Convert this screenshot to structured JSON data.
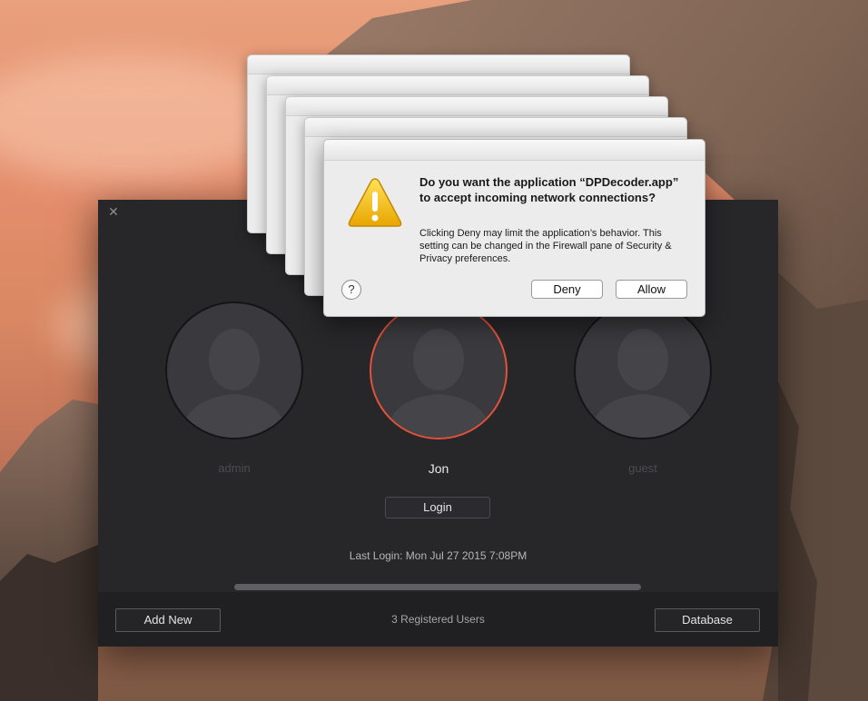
{
  "app": {
    "close_glyph": "✕",
    "users": [
      {
        "name": "admin",
        "selected": false
      },
      {
        "name": "Jon",
        "selected": true
      },
      {
        "name": "guest",
        "selected": false
      }
    ],
    "login_label": "Login",
    "last_login": "Last Login: Mon Jul 27 2015 7:08PM",
    "footer": {
      "add_new_label": "Add New",
      "status": "3 Registered Users",
      "database_label": "Database"
    }
  },
  "dialog": {
    "title": "Do you want the application “DPDecoder.app” to accept incoming network connections?",
    "body": "Clicking Deny may limit the application’s behavior. This setting can be changed in the Firewall pane of Security & Privacy preferences.",
    "help_glyph": "?",
    "deny_label": "Deny",
    "allow_label": "Allow",
    "icon": "warning-icon"
  },
  "colors": {
    "selected_ring": "#e2523a",
    "app_background": "#272629",
    "dialog_background": "#ececec"
  }
}
